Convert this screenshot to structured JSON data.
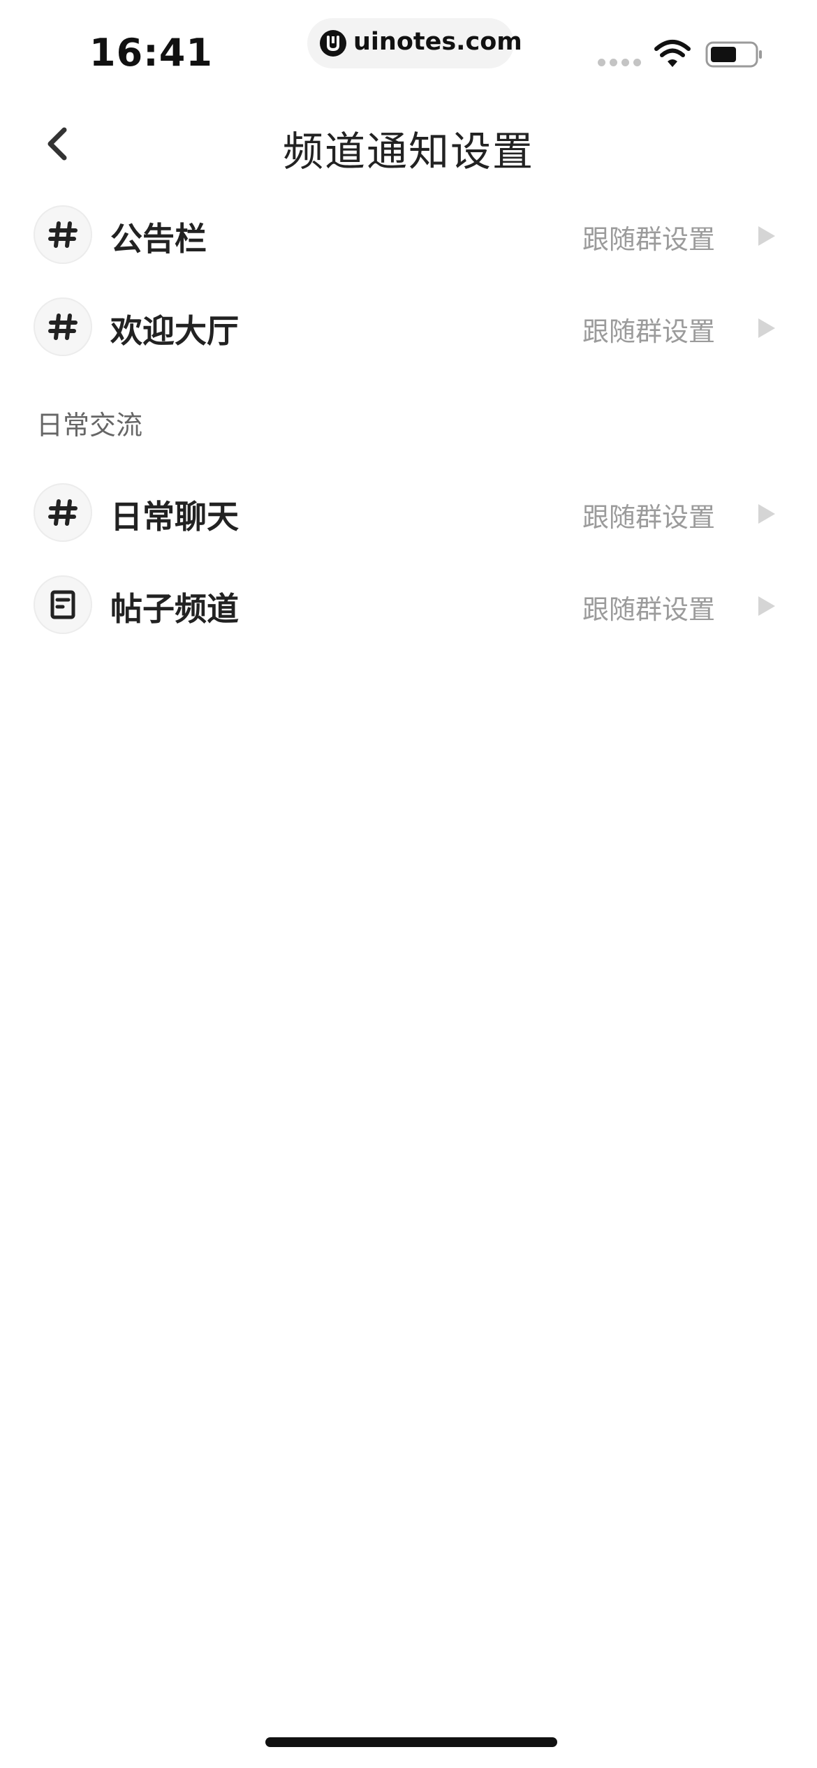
{
  "status_bar": {
    "time": "16:41",
    "url": "uinotes.com"
  },
  "nav": {
    "title": "频道通知设置"
  },
  "channels_top": [
    {
      "name": "公告栏",
      "setting": "跟随群设置",
      "icon": "hash-icon"
    },
    {
      "name": "欢迎大厅",
      "setting": "跟随群设置",
      "icon": "hash-icon"
    }
  ],
  "section": {
    "label": "日常交流"
  },
  "channels_section": [
    {
      "name": "日常聊天",
      "setting": "跟随群设置",
      "icon": "hash-icon"
    },
    {
      "name": "帖子频道",
      "setting": "跟随群设置",
      "icon": "post-icon"
    }
  ],
  "colors": {
    "text_primary": "#222222",
    "text_secondary": "#9b9b9b",
    "arrow": "#d5d5d5",
    "icon_bg": "#f6f6f6"
  }
}
